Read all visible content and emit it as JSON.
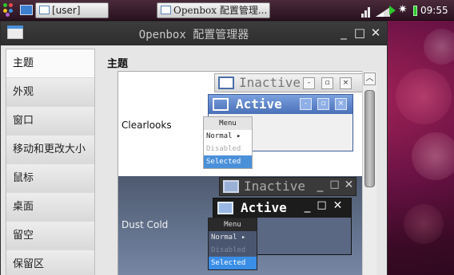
{
  "taskbar": {
    "tasks": [
      {
        "label": "[user]"
      },
      {
        "label": "Openbox 配置管理..."
      }
    ],
    "clock": "09:55"
  },
  "window": {
    "title": "Openbox 配置管理器",
    "controls": {
      "minimize": "_",
      "maximize": "□",
      "close": "✕"
    }
  },
  "sidebar": {
    "items": [
      {
        "label": "主题"
      },
      {
        "label": "外观"
      },
      {
        "label": "窗口"
      },
      {
        "label": "移动和更改大小"
      },
      {
        "label": "鼠标"
      },
      {
        "label": "桌面"
      },
      {
        "label": "留空"
      },
      {
        "label": "保留区"
      }
    ],
    "selected_index": 0
  },
  "main": {
    "heading": "主题",
    "themes": [
      {
        "name": "Clearlooks",
        "preview": {
          "inactive_title": "Inactive",
          "active_title": "Active",
          "menu_title": "Menu",
          "menu_items": [
            "Normal",
            "Disabled",
            "Selected"
          ],
          "submenu_arrow": "▸"
        }
      },
      {
        "name": "Dust Cold",
        "preview": {
          "inactive_title": "Inactive",
          "active_title": "Active",
          "menu_title": "Menu",
          "menu_items": [
            "Normal",
            "Disabled",
            "Selected"
          ],
          "submenu_arrow": "▸"
        }
      }
    ]
  },
  "colors": {
    "desktop": "#6a1244",
    "window_title_bg": "#353535",
    "clearlooks_active": "#4a70b8",
    "clearlooks_inactive": "#e2e2e2",
    "dustcold_bg": "#5e6c88",
    "selected_blue": "#3a8ee6"
  }
}
